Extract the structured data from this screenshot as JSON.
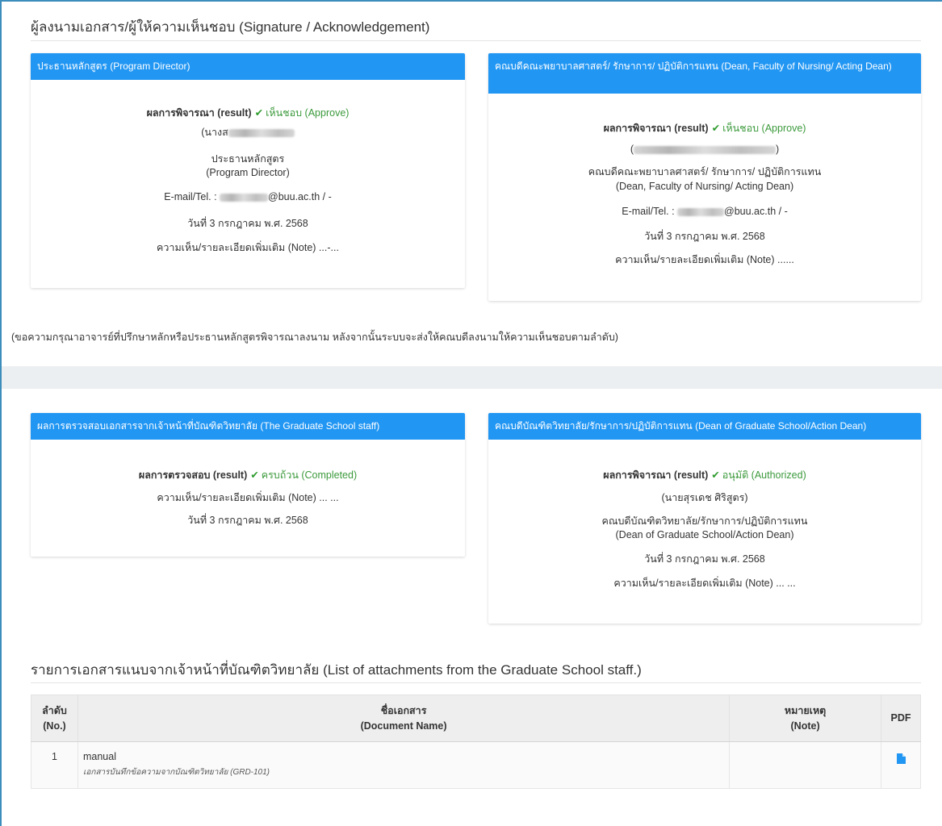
{
  "signature_section": {
    "title": "ผู้ลงนามเอกสาร/ผู้ให้ความเห็นชอบ (Signature / Acknowledgement)",
    "program_director": {
      "header": "ประธานหลักสูตร (Program Director)",
      "result_label": "ผลการพิจารณา (result)",
      "result_value": "เห็นชอบ (Approve)",
      "name_prefix": "(นางส",
      "position_th": "ประธานหลักสูตร",
      "position_en": "(Program Director)",
      "email_prefix": "E-mail/Tel. : ",
      "email_suffix": "@buu.ac.th / -",
      "date": "วันที่ 3 กรกฎาคม พ.ศ. 2568",
      "note": "ความเห็น/รายละเอียดเพิ่มเติม (Note) ...-..."
    },
    "dean_nursing": {
      "header": "คณบดีคณะพยาบาลศาสตร์/ รักษาการ/ ปฏิบัติการแทน (Dean, Faculty of Nursing/ Acting Dean)",
      "result_label": "ผลการพิจารณา (result)",
      "result_value": "เห็นชอบ (Approve)",
      "name_prefix": "(",
      "name_suffix": ")",
      "position_th": "คณบดีคณะพยาบาลศาสตร์/ รักษาการ/ ปฏิบัติการแทน",
      "position_en": "(Dean, Faculty of Nursing/ Acting Dean)",
      "email_prefix": "E-mail/Tel. : ",
      "email_suffix": "@buu.ac.th / -",
      "date": "วันที่ 3 กรกฎาคม พ.ศ. 2568",
      "note": "ความเห็น/รายละเอียดเพิ่มเติม (Note) ......"
    },
    "advisory_note": "(ขอความกรุณาอาจารย์ที่ปรึกษาหลักหรือประธานหลักสูตรพิจารณาลงนาม หลังจากนั้นระบบจะส่งให้คณบดีลงนามให้ความเห็นชอบตามลำดับ)"
  },
  "graduate_section": {
    "staff": {
      "header": "ผลการตรวจสอบเอกสารจากเจ้าหน้าที่บัณฑิตวิทยาลัย (The Graduate School staff)",
      "result_label": "ผลการตรวจสอบ (result)",
      "result_value": "ครบถ้วน (Completed)",
      "note": "ความเห็น/รายละเอียดเพิ่มเติม (Note) ... ...",
      "date": "วันที่ 3 กรกฎาคม พ.ศ. 2568"
    },
    "dean_graduate": {
      "header": "คณบดีบัณฑิตวิทยาลัย/รักษาการ/ปฏิบัติการแทน (Dean of Graduate School/Action Dean)",
      "result_label": "ผลการพิจารณา (result)",
      "result_value": "อนุมัติ (Authorized)",
      "name": "(นายสุรเดช ศิริสูตร)",
      "position_th": "คณบดีบัณฑิตวิทยาลัย/รักษาการ/ปฏิบัติการแทน",
      "position_en": "(Dean of Graduate School/Action Dean)",
      "date": "วันที่ 3 กรกฎาคม พ.ศ. 2568",
      "note": "ความเห็น/รายละเอียดเพิ่มเติม (Note) ... ..."
    }
  },
  "attachments": {
    "title": "รายการเอกสารแนบจากเจ้าหน้าที่บัณฑิตวิทยาลัย  (List of attachments from the Graduate School staff.)",
    "columns": {
      "no_th": "ลำดับ",
      "no_en": "(No.)",
      "name_th": "ชื่อเอกสาร",
      "name_en": "(Document Name)",
      "note_th": "หมายเหตุ",
      "note_en": "(Note)",
      "pdf": "PDF"
    },
    "rows": [
      {
        "no": "1",
        "name": "manual",
        "subtitle": "เอกสารบันทึกข้อความจากบัณฑิตวิทยาลัย (GRD-101)",
        "note": "",
        "pdf_icon": "file-icon"
      }
    ]
  },
  "colors": {
    "header_blue": "#2196f3",
    "approve_green": "#3c9a3c",
    "band_gray": "#eceff1"
  }
}
